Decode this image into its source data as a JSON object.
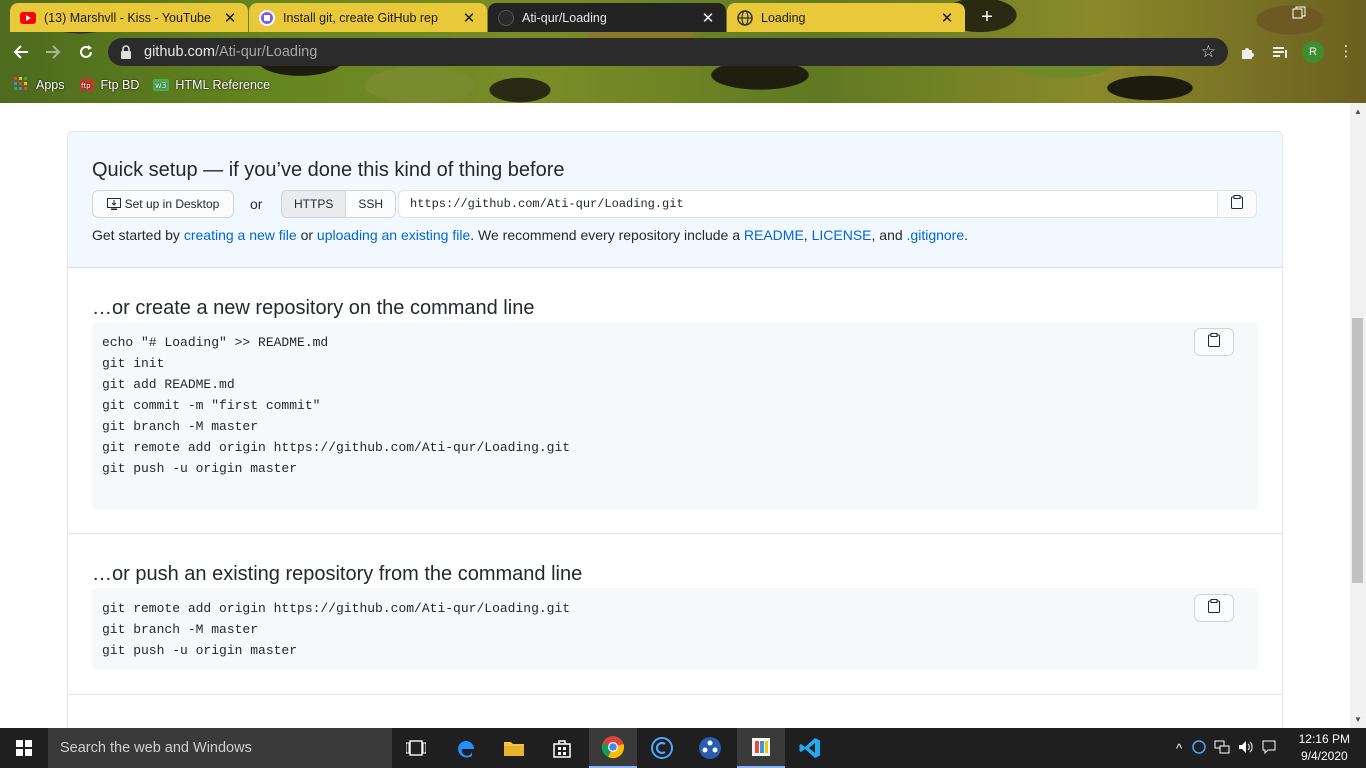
{
  "browser": {
    "tabs": [
      {
        "title": "(13) Marshvll - Kiss - YouTube",
        "favicon": "youtube-icon",
        "active": false
      },
      {
        "title": "Install git, create GitHub rep",
        "favicon": "google-docs-icon",
        "active": false
      },
      {
        "title": "Ati-qur/Loading",
        "favicon": "github-icon",
        "active": true
      },
      {
        "title": "Loading",
        "favicon": "globe-icon",
        "active": false
      }
    ],
    "url_host": "github.com",
    "url_path": "/Ati-qur/Loading",
    "profile_initial": "R",
    "bookmarks": [
      {
        "label": "Apps",
        "icon": "apps-grid-icon"
      },
      {
        "label": "Ftp BD",
        "icon": "ftp-icon"
      },
      {
        "label": "HTML Reference",
        "icon": "w3-icon"
      }
    ]
  },
  "quick_setup": {
    "title": "Quick setup — if you’ve done this kind of thing before",
    "desktop_button": "Set up in Desktop",
    "or_label": "or",
    "protocols": [
      "HTTPS",
      "SSH"
    ],
    "selected_protocol": "HTTPS",
    "clone_url": "https://github.com/Ati-qur/Loading.git",
    "hint_prefix": "Get started by",
    "hint_link_new_file": "creating a new file",
    "hint_or": "or",
    "hint_link_upload": "uploading an existing file",
    "hint_middle": ". We recommend every repository include a",
    "hint_link_readme": "README",
    "hint_link_license": "LICENSE",
    "hint_and": ", and",
    "hint_link_gitignore": ".gitignore",
    "hint_end": "."
  },
  "new_repo_section": {
    "title": "…or create a new repository on the command line",
    "code": "echo \"# Loading\" >> README.md\ngit init\ngit add README.md\ngit commit -m \"first commit\"\ngit branch -M master\ngit remote add origin https://github.com/Ati-qur/Loading.git\ngit push -u origin master"
  },
  "push_existing_section": {
    "title": "…or push an existing repository from the command line",
    "code": "git remote add origin https://github.com/Ati-qur/Loading.git\ngit branch -M master\ngit push -u origin master"
  },
  "taskbar": {
    "search_placeholder": "Search the web and Windows",
    "pinned": [
      "task-view-icon",
      "edge-icon",
      "file-explorer-icon",
      "store-icon",
      "chrome-icon",
      "ccleaner-icon",
      "davinci-icon",
      "paint-icon",
      "vscode-icon"
    ],
    "time": "12:16 PM",
    "date": "9/4/2020"
  },
  "colors": {
    "link": "#0366d6",
    "quick_setup_bg": "#f1f8ff",
    "code_bg": "#f6f8fa",
    "tab_inactive": "#e9c83a",
    "tab_active": "#232323"
  }
}
